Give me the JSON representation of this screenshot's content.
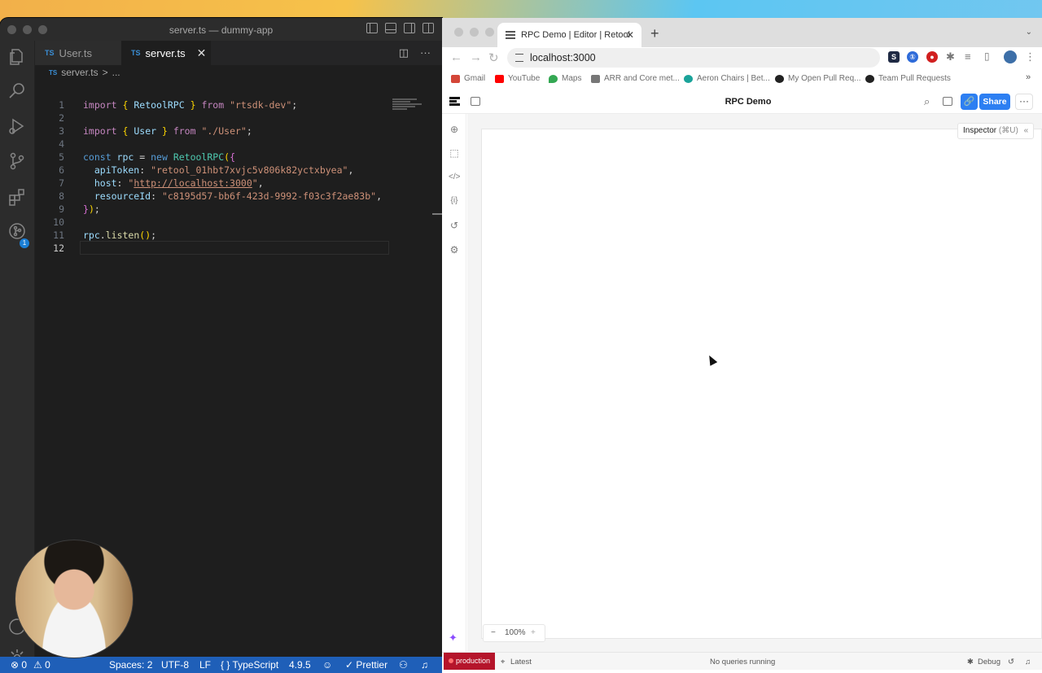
{
  "vscode": {
    "window_title": "server.ts — dummy-app",
    "tabs": [
      {
        "lang": "TS",
        "label": "User.ts"
      },
      {
        "lang": "TS",
        "label": "server.ts",
        "close": "✕"
      }
    ],
    "breadcrumb": {
      "lang": "TS",
      "file": "server.ts",
      "sep": ">",
      "rest": "..."
    },
    "extensions_badge": "1",
    "lines": [
      "1",
      "2",
      "3",
      "4",
      "5",
      "6",
      "7",
      "8",
      "9",
      "10",
      "11",
      "12"
    ],
    "code": {
      "l1": {
        "kw": "import",
        "p1": " ",
        "br": "{",
        "name": " RetoolRPC ",
        "br2": "}",
        "from": " from ",
        "str": "\"rtsdk-dev\"",
        "end": ";"
      },
      "l3": {
        "kw": "import",
        "p1": " ",
        "br": "{",
        "name": " User ",
        "br2": "}",
        "from": " from ",
        "str": "\"./User\"",
        "end": ";"
      },
      "l5": {
        "kw": "const",
        "var": " rpc",
        "eq": " = ",
        "new": "new",
        "cls": " RetoolRPC",
        "p": "(",
        "br": "{"
      },
      "l6": {
        "key": "  apiToken",
        "colon": ": ",
        "str": "\"retool_01hbt7xvjc5v806k82yctxbyea\"",
        "end": ","
      },
      "l7": {
        "key": "  host",
        "colon": ": ",
        "q1": "\"",
        "url": "http://localhost:3000",
        "q2": "\"",
        "end": ","
      },
      "l8": {
        "key": "  resourceId",
        "colon": ": ",
        "str": "\"c8195d57-bb6f-423d-9992-f03c3f2ae83b\"",
        "end": ","
      },
      "l9": {
        "br": "}",
        "p": ")",
        "end": ";"
      },
      "l11": {
        "var": "rpc",
        "dot": ".",
        "fn": "listen",
        "p": "()",
        "end": ";"
      }
    },
    "status": {
      "errors": "⊗ 0",
      "warnings": "⚠ 0",
      "spaces": "Spaces: 2",
      "encoding": "UTF-8",
      "eol": "LF",
      "language": "{ } TypeScript",
      "ts_version": "4.9.5",
      "prettier": "✓ Prettier"
    }
  },
  "browser": {
    "tab_title": "RPC Demo | Editor | Retool",
    "tab_close": "✕",
    "new_tab": "+",
    "url": "localhost:3000",
    "nav": {
      "back": "←",
      "forward": "→",
      "reload": "↻"
    },
    "extensions": [
      {
        "label": "S",
        "color": "#1f2a44"
      },
      {
        "label": "①",
        "color": "#2e6bd9"
      },
      {
        "label": "●",
        "color": "#d11f1f"
      }
    ],
    "bookmarks": [
      {
        "label": "Gmail",
        "color": "#d44638"
      },
      {
        "label": "YouTube",
        "color": "#ff0000"
      },
      {
        "label": "Maps",
        "color": "#34a853"
      },
      {
        "label": "ARR and Core met...",
        "color": "#555555"
      },
      {
        "label": "Aeron Chairs | Bet...",
        "color": "#1aa39a"
      },
      {
        "label": "My Open Pull Req...",
        "color": "#222222"
      },
      {
        "label": "Team Pull Requests",
        "color": "#222222"
      }
    ],
    "bookmarks_more": "»",
    "tab_menu": "⌄"
  },
  "retool": {
    "app_title": "RPC Demo",
    "share_label": "Share",
    "link_icon": "🔗",
    "more": "···",
    "search": "⌕",
    "inspector": {
      "label": "Inspector",
      "shortcut": " (⌘U)",
      "collapse": "«"
    },
    "zoom": {
      "minus": "−",
      "value": "100%",
      "plus": "+"
    },
    "sparkle": "✦",
    "status": {
      "env": "production",
      "version": "Latest",
      "queries": "No queries running",
      "debug": "Debug"
    }
  }
}
